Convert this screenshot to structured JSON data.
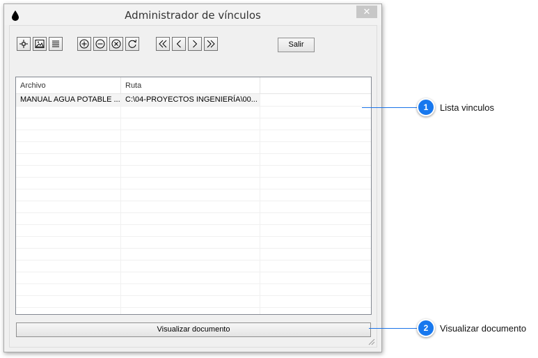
{
  "window": {
    "title": "Administrador de vínculos",
    "close_glyph": "✕",
    "icon": "droplet-icon"
  },
  "toolbar": {
    "buttons": [
      {
        "name": "locate-button",
        "icon": "crosshair-icon"
      },
      {
        "name": "image-button",
        "icon": "image-icon"
      },
      {
        "name": "list-button",
        "icon": "list-icon"
      },
      {
        "name": "add-button",
        "icon": "plus-circle-icon"
      },
      {
        "name": "remove-button",
        "icon": "minus-circle-icon"
      },
      {
        "name": "delete-button",
        "icon": "x-circle-icon"
      },
      {
        "name": "refresh-button",
        "icon": "refresh-icon"
      },
      {
        "name": "first-button",
        "icon": "double-chevron-left-icon"
      },
      {
        "name": "previous-button",
        "icon": "chevron-left-icon"
      },
      {
        "name": "next-button",
        "icon": "chevron-right-icon"
      },
      {
        "name": "last-button",
        "icon": "double-chevron-right-icon"
      }
    ],
    "salir_label": "Salir"
  },
  "list": {
    "columns": [
      "Archivo",
      "Ruta",
      ""
    ],
    "rows": [
      [
        "MANUAL AGUA POTABLE ...",
        "C:\\04-PROYECTOS INGENIERÍA\\00...",
        ""
      ]
    ]
  },
  "visualizar_label": "Visualizar documento",
  "callouts": [
    {
      "number": "1",
      "label": "Lista vinculos"
    },
    {
      "number": "2",
      "label": "Visualizar documento"
    }
  ],
  "colors": {
    "callout_blue": "#1878ee"
  }
}
